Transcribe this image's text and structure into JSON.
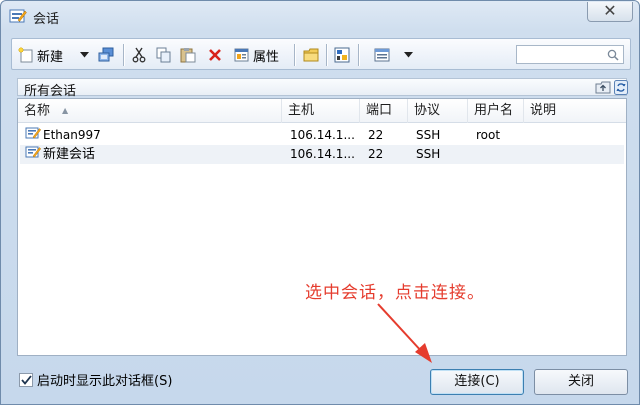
{
  "window": {
    "title": "会话",
    "close_glyph": "✕"
  },
  "toolbar": {
    "new_label": "新建",
    "properties_label": "属性",
    "search": {
      "value": "",
      "placeholder": ""
    },
    "icons": [
      "new-session-icon",
      "dropdown-arrow-icon",
      "connect-session-icon",
      "cut-icon",
      "copy-icon",
      "paste-icon",
      "delete-icon",
      "properties-icon",
      "folder-icon",
      "session-config-icon",
      "view-icon",
      "view-dropdown-arrow-icon",
      "search-icon"
    ]
  },
  "path": {
    "text": "所有会话"
  },
  "list": {
    "columns": [
      "名称",
      "主机",
      "端口",
      "协议",
      "用户名",
      "说明"
    ],
    "sort_indicator": "▲",
    "rows": [
      {
        "name": "Ethan997",
        "host": "106.14.1...",
        "port": "22",
        "protocol": "SSH",
        "user": "root",
        "note": ""
      },
      {
        "name": "新建会话",
        "host": "106.14.1...",
        "port": "22",
        "protocol": "SSH",
        "user": "",
        "note": ""
      }
    ]
  },
  "annotation": {
    "text": "选中会话，点击连接。",
    "color": "#e53c2e"
  },
  "footer": {
    "show_on_startup_label": "启动时显示此对话框(S)",
    "show_on_startup_checked": true,
    "connect_label": "连接(C)",
    "close_label": "关闭"
  },
  "colors": {
    "accent": "#3c7fb1",
    "annotation": "#e53c2e"
  }
}
